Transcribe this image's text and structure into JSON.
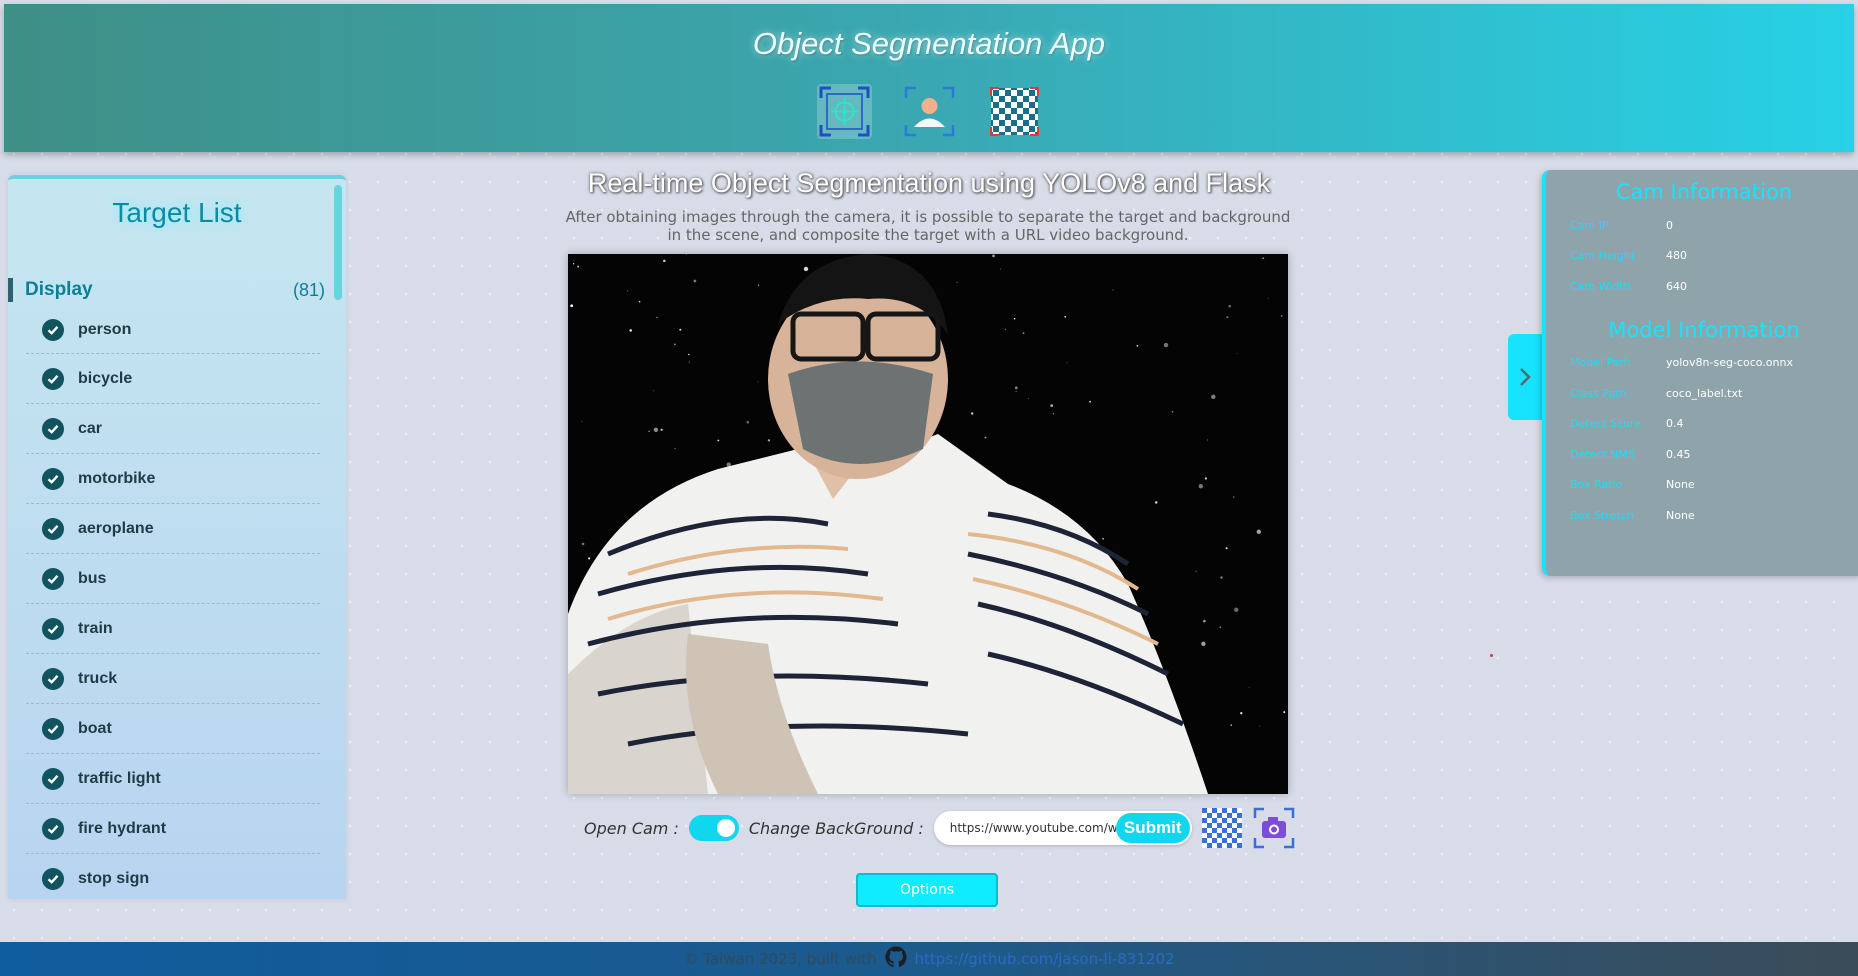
{
  "header": {
    "title": "Object Segmentation App",
    "icons": [
      "target-detect-icon",
      "person-segment-icon",
      "transparent-background-icon"
    ]
  },
  "target_list": {
    "title": "Target List",
    "display_label": "Display",
    "display_count": "(81)",
    "items": [
      "person",
      "bicycle",
      "car",
      "motorbike",
      "aeroplane",
      "bus",
      "train",
      "truck",
      "boat",
      "traffic light",
      "fire hydrant",
      "stop sign"
    ]
  },
  "main": {
    "title": "Real-time Object Segmentation using YOLOv8 and Flask",
    "description": "After obtaining images through the camera, it is possible to separate the target and background in the scene, and composite the target with a URL video background."
  },
  "controls": {
    "open_cam_label": "Open Cam :",
    "open_cam_on": true,
    "change_bg_label": "Change BackGround :",
    "url_value": "https://www.youtube.com/watc",
    "submit_label": "Submit",
    "options_label": "Options"
  },
  "cam_info": {
    "title": "Cam Information",
    "rows": [
      {
        "key": "Cam IP",
        "value": "0"
      },
      {
        "key": "Cam Height",
        "value": "480"
      },
      {
        "key": "Cam Width",
        "value": "640"
      }
    ]
  },
  "model_info": {
    "title": "Model Information",
    "rows": [
      {
        "key": "Model Path",
        "value": "yolov8n-seg-coco.onnx"
      },
      {
        "key": "Class Path",
        "value": "coco_label.txt"
      },
      {
        "key": "Detect Score",
        "value": "0.4"
      },
      {
        "key": "Detect NMS",
        "value": "0.45"
      },
      {
        "key": "Box Ratio",
        "value": "None"
      },
      {
        "key": "Box Stretch",
        "value": "None"
      }
    ]
  },
  "footer": {
    "text": "© Taiwan 2023, built with",
    "link": "https://github.com/jason-li-831202"
  },
  "colors": {
    "accent": "#17e3ff",
    "header_start": "#3e8f86",
    "header_end": "#27d1e6",
    "check": "#11545f"
  }
}
